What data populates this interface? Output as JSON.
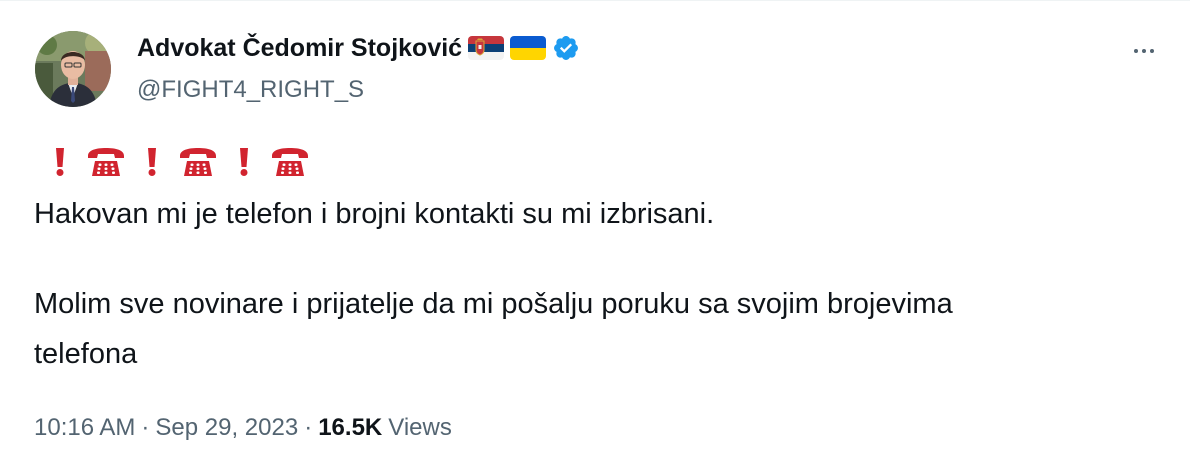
{
  "author": {
    "name": "Advokat Čedomir Stojković",
    "handle": "@FIGHT4_RIGHT_S",
    "verified_color": "#1d9bf0"
  },
  "flags": [
    "serbia-flag",
    "ukraine-flag"
  ],
  "emoji_row": [
    "exclamation-icon",
    "telephone-icon",
    "exclamation-icon",
    "telephone-icon",
    "exclamation-icon",
    "telephone-icon"
  ],
  "tweet": {
    "line1": "Hakovan mi je telefon i brojni kontakti su mi izbrisani.",
    "line2": "Molim sve novinare i prijatelje da mi pošalju poruku sa svojim brojevima",
    "line3": "telefona"
  },
  "meta": {
    "time": "10:16 AM",
    "separator": "·",
    "date": "Sep 29, 2023",
    "views_count": "16.5K",
    "views_label": "Views"
  },
  "colors": {
    "text": "#0f1419",
    "secondary": "#536471",
    "accent": "#1d9bf0",
    "emoji_red": "#d1242f"
  }
}
